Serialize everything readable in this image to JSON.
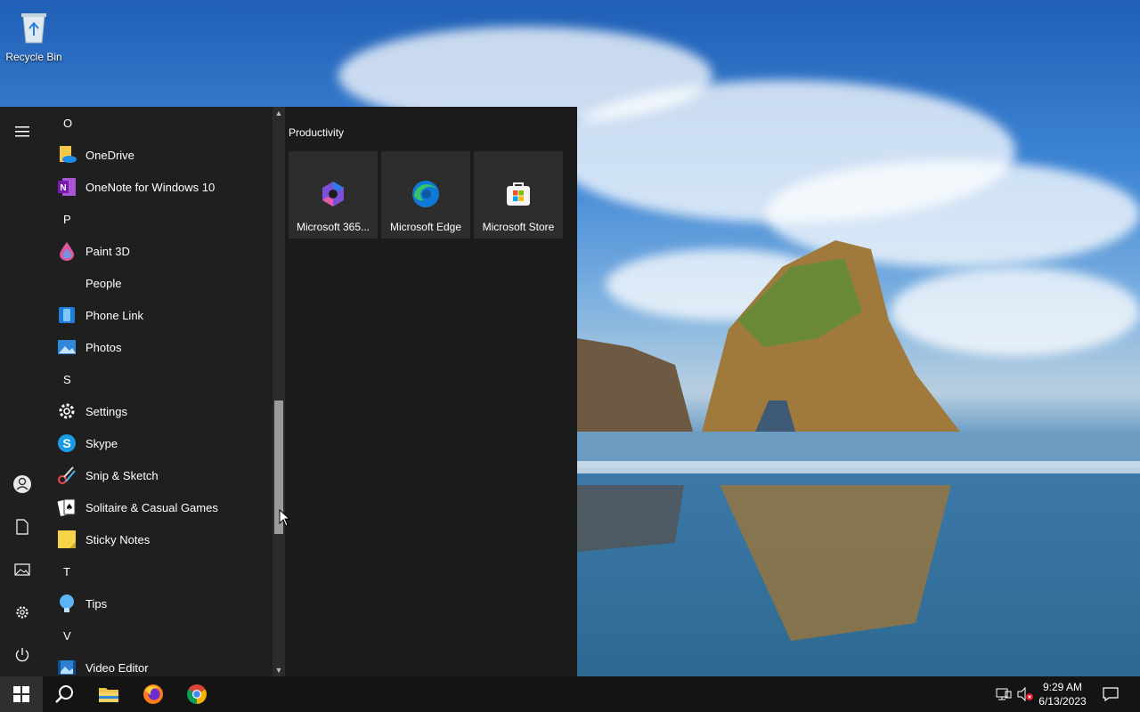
{
  "desktop": {
    "icons": [
      {
        "label": "Recycle Bin",
        "icon": "recycle-bin-icon"
      }
    ]
  },
  "start_menu": {
    "rail": [
      "hamburger-icon",
      "user-icon",
      "documents-icon",
      "pictures-icon",
      "settings-icon",
      "power-icon"
    ],
    "apps": [
      {
        "type": "letter",
        "label": "O"
      },
      {
        "type": "app",
        "label": "OneDrive",
        "icon": "onedrive-icon"
      },
      {
        "type": "app",
        "label": "OneNote for Windows 10",
        "icon": "onenote-icon"
      },
      {
        "type": "letter",
        "label": "P"
      },
      {
        "type": "app",
        "label": "Paint 3D",
        "icon": "paint3d-icon"
      },
      {
        "type": "app",
        "label": "People",
        "icon": "people-icon"
      },
      {
        "type": "app",
        "label": "Phone Link",
        "icon": "phone-link-icon"
      },
      {
        "type": "app",
        "label": "Photos",
        "icon": "photos-icon"
      },
      {
        "type": "letter",
        "label": "S"
      },
      {
        "type": "app",
        "label": "Settings",
        "icon": "settings-icon"
      },
      {
        "type": "app",
        "label": "Skype",
        "icon": "skype-icon"
      },
      {
        "type": "app",
        "label": "Snip & Sketch",
        "icon": "snip-sketch-icon"
      },
      {
        "type": "app",
        "label": "Solitaire & Casual Games",
        "icon": "solitaire-icon"
      },
      {
        "type": "app",
        "label": "Sticky Notes",
        "icon": "sticky-notes-icon"
      },
      {
        "type": "letter",
        "label": "T"
      },
      {
        "type": "app",
        "label": "Tips",
        "icon": "tips-icon"
      },
      {
        "type": "letter",
        "label": "V"
      },
      {
        "type": "app",
        "label": "Video Editor",
        "icon": "video-editor-icon"
      }
    ],
    "tiles_group": "Productivity",
    "tiles": [
      {
        "label": "Microsoft 365...",
        "icon": "microsoft365-icon"
      },
      {
        "label": "Microsoft Edge",
        "icon": "edge-icon"
      },
      {
        "label": "Microsoft Store",
        "icon": "store-icon"
      }
    ]
  },
  "taskbar": {
    "buttons": [
      "start-icon",
      "search-icon",
      "file-explorer-icon",
      "firefox-icon",
      "chrome-icon"
    ],
    "tray": [
      "network-icon",
      "volume-muted-icon"
    ],
    "time": "9:29 AM",
    "date": "6/13/2023",
    "notifications": "action-center-icon"
  },
  "colors": {
    "start_bg": "#1f1f1f",
    "tile_bg": "#2d2d2d",
    "taskbar_bg": "#141414"
  }
}
